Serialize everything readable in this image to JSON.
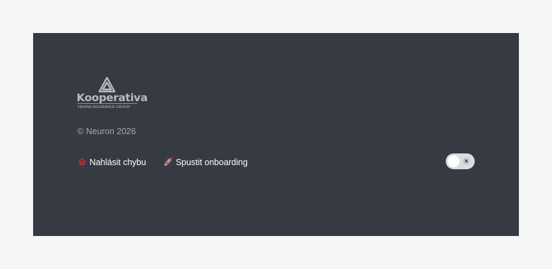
{
  "footer": {
    "logo": {
      "name": "Kooperativa",
      "tagline": "VIENNA INSURANCE GROUP"
    },
    "copyright": "© Neuron 2026",
    "links": [
      {
        "icon": "bug-icon",
        "label": "Nahlásit chybu"
      },
      {
        "icon": "rocket-icon",
        "label": "Spustit onboarding"
      }
    ],
    "theme_toggle": {
      "state": "light",
      "icon": "sun-icon"
    }
  },
  "colors": {
    "page_background": "#f5f6f8",
    "footer_background": "#363a43",
    "link_text": "#ffffff",
    "muted_text": "#a4a9b1",
    "toggle_track": "#d9dce1"
  }
}
